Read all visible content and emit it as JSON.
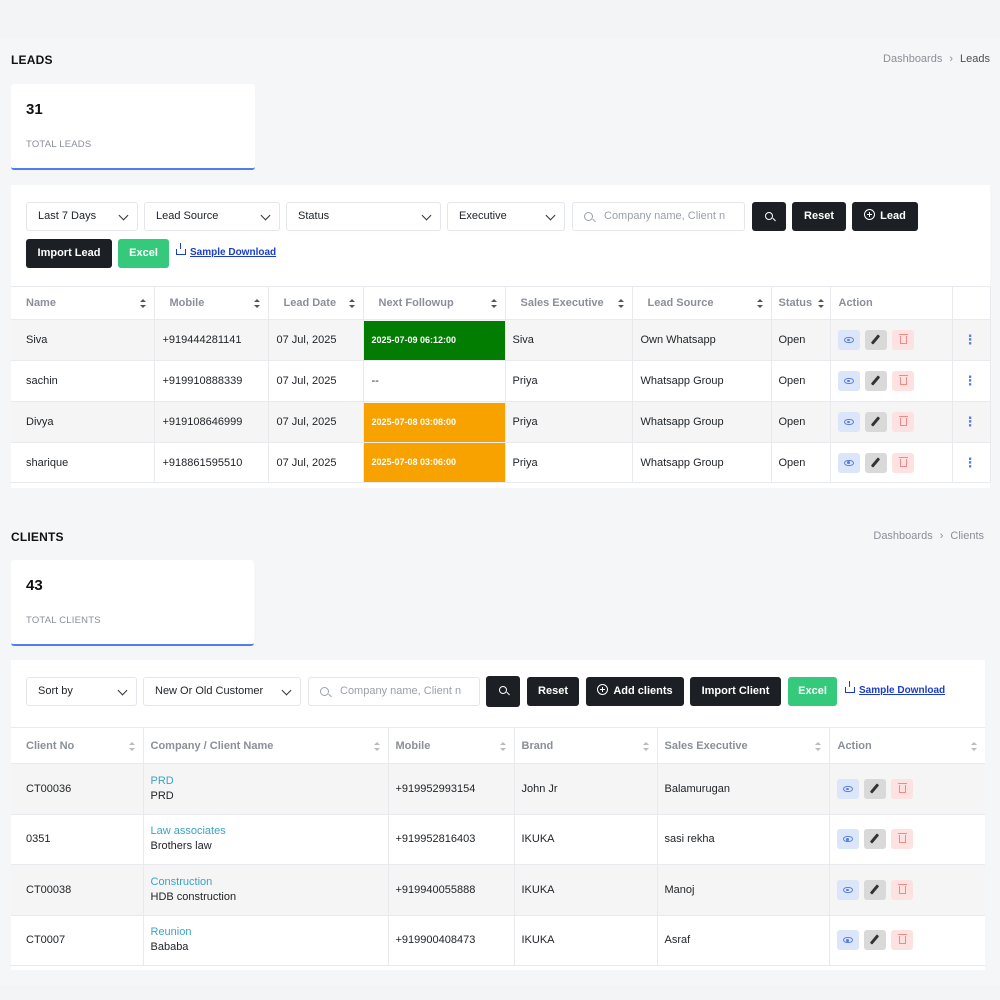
{
  "leads": {
    "title": "LEADS",
    "breadcrumb": {
      "parent": "Dashboards",
      "current": "Leads"
    },
    "stat": {
      "value": "31",
      "label": "TOTAL LEADS"
    },
    "filters": {
      "date_range": "Last 7 Days",
      "lead_source": "Lead Source",
      "status": "Status",
      "executive": "Executive",
      "search_placeholder": "Company name, Client n"
    },
    "buttons": {
      "reset": "Reset",
      "add_lead": "Lead",
      "import": "Import Lead",
      "excel": "Excel",
      "sample": "Sample Download"
    },
    "columns": [
      "Name",
      "Mobile",
      "Lead Date",
      "Next Followup",
      "Sales Executive",
      "Lead Source",
      "Status",
      "Action"
    ],
    "rows": [
      {
        "name": "Siva",
        "mobile": "+919444281141",
        "date": "07 Jul, 2025",
        "followup": "2025-07-09 06:12:00",
        "followup_color": "#037c02",
        "exec": "Siva",
        "source": "Own Whatsapp",
        "status": "Open"
      },
      {
        "name": "sachin",
        "mobile": "+919910888339",
        "date": "07 Jul, 2025",
        "followup": "--",
        "followup_color": "",
        "exec": "Priya",
        "source": "Whatsapp Group",
        "status": "Open"
      },
      {
        "name": "Divya",
        "mobile": "+919108646999",
        "date": "07 Jul, 2025",
        "followup": "2025-07-08 03:08:00",
        "followup_color": "#f8a200",
        "exec": "Priya",
        "source": "Whatsapp Group",
        "status": "Open"
      },
      {
        "name": "sharique",
        "mobile": "+918861595510",
        "date": "07 Jul, 2025",
        "followup": "2025-07-08 03:06:00",
        "followup_color": "#f8a200",
        "exec": "Priya",
        "source": "Whatsapp Group",
        "status": "Open"
      }
    ]
  },
  "clients": {
    "title": "CLIENTS",
    "breadcrumb": {
      "parent": "Dashboards",
      "current": "Clients"
    },
    "stat": {
      "value": "43",
      "label": "TOTAL CLIENTS"
    },
    "filters": {
      "sort": "Sort by",
      "customer_type": "New Or Old Customer",
      "search_placeholder": "Company name, Client n"
    },
    "buttons": {
      "reset": "Reset",
      "add": "Add clients",
      "import": "Import Client",
      "excel": "Excel",
      "sample": "Sample Download"
    },
    "columns": [
      "Client No",
      "Company / Client Name",
      "Mobile",
      "Brand",
      "Sales Executive",
      "Action"
    ],
    "rows": [
      {
        "no": "CT00036",
        "company": "PRD",
        "client": "PRD",
        "mobile": "+919952993154",
        "brand": "John Jr",
        "exec": "Balamurugan"
      },
      {
        "no": "0351",
        "company": "Law associates",
        "client": "Brothers law",
        "mobile": "+919952816403",
        "brand": "IKUKA",
        "exec": "sasi rekha"
      },
      {
        "no": "CT00038",
        "company": "Construction",
        "client": "HDB construction",
        "mobile": "+919940055888",
        "brand": "IKUKA",
        "exec": "Manoj"
      },
      {
        "no": "CT0007",
        "company": "Reunion",
        "client": "Bababa",
        "mobile": "+919900408473",
        "brand": "IKUKA",
        "exec": "Asraf"
      }
    ]
  }
}
